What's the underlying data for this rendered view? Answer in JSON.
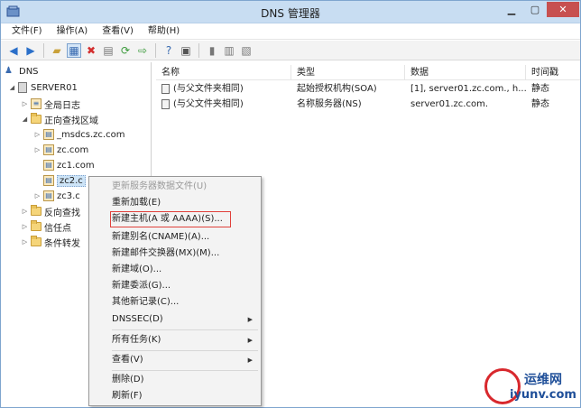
{
  "window": {
    "title": "DNS 管理器"
  },
  "menu": [
    "文件(F)",
    "操作(A)",
    "查看(V)",
    "帮助(H)"
  ],
  "tree": {
    "root": "DNS",
    "server": "SERVER01",
    "global_log": "全局日志",
    "forward_zones": "正向查找区域",
    "zones": [
      "_msdcs.zc.com",
      "zc.com",
      "zc1.com",
      "zc2.c",
      "zc3.c"
    ],
    "reverse_zones": "反向查找",
    "trust_points": "信任点",
    "conditional_forwarders": "条件转发"
  },
  "list": {
    "columns": [
      "名称",
      "类型",
      "数据",
      "时间戳"
    ],
    "rows": [
      {
        "name": "(与父文件夹相同)",
        "type": "起始授权机构(SOA)",
        "data": "[1], server01.zc.com., h...",
        "timestamp": "静态"
      },
      {
        "name": "(与父文件夹相同)",
        "type": "名称服务器(NS)",
        "data": "server01.zc.com.",
        "timestamp": "静态"
      }
    ]
  },
  "context_menu": {
    "items": [
      "更新服务器数据文件(U)",
      "重新加载(E)",
      "新建主机(A 或 AAAA)(S)...",
      "新建别名(CNAME)(A)...",
      "新建邮件交换器(MX)(M)...",
      "新建域(O)...",
      "新建委派(G)...",
      "其他新记录(C)...",
      "DNSSEC(D)",
      "所有任务(K)",
      "查看(V)",
      "删除(D)",
      "刷新(F)"
    ]
  },
  "watermark": {
    "line1": "运维网",
    "line2": "iyunv.com"
  }
}
